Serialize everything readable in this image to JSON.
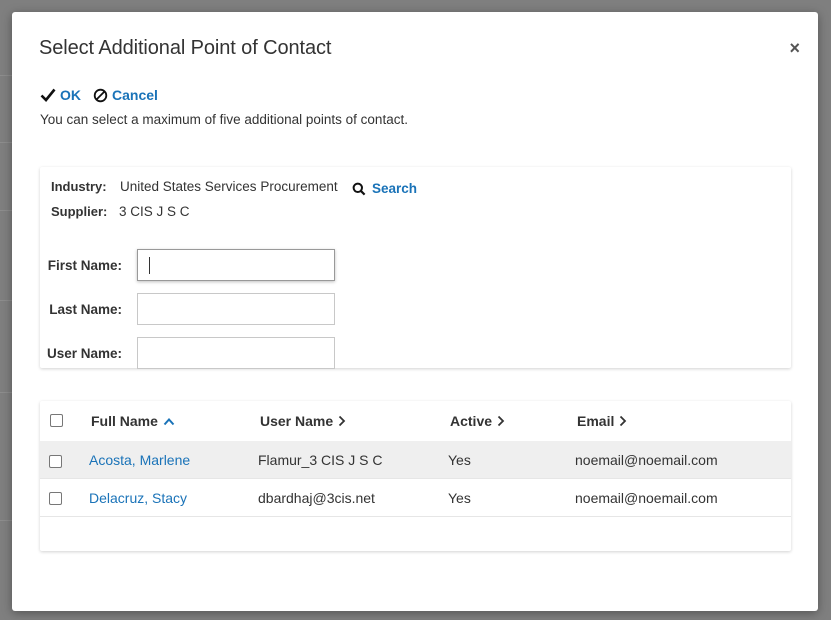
{
  "dialog": {
    "title": "Select Additional Point of Contact",
    "close_label": "×",
    "ok_label": "OK",
    "cancel_label": "Cancel",
    "info_text": "You can select a maximum of five additional points of contact."
  },
  "filters": {
    "industry_label": "Industry:",
    "industry_value": "United States Services Procurement",
    "search_label": "Search",
    "supplier_label": "Supplier:",
    "supplier_value": "3 CIS J S C",
    "first_name_label": "First Name:",
    "first_name_value": "",
    "last_name_label": "Last Name:",
    "last_name_value": "",
    "user_name_label": "User Name:",
    "user_name_value": ""
  },
  "table": {
    "columns": [
      "Full Name",
      "User Name",
      "Active",
      "Email"
    ],
    "rows": [
      {
        "full_name": "Acosta, Marlene",
        "user_name": "Flamur_3 CIS J S C",
        "active": "Yes",
        "email": "noemail@noemail.com"
      },
      {
        "full_name": "Delacruz, Stacy",
        "user_name": "dbardhaj@3cis.net",
        "active": "Yes",
        "email": "noemail@noemail.com"
      }
    ]
  },
  "colors": {
    "link": "#1a73b8",
    "row_alt": "#efefef",
    "overlay": "#7f7f7f"
  }
}
